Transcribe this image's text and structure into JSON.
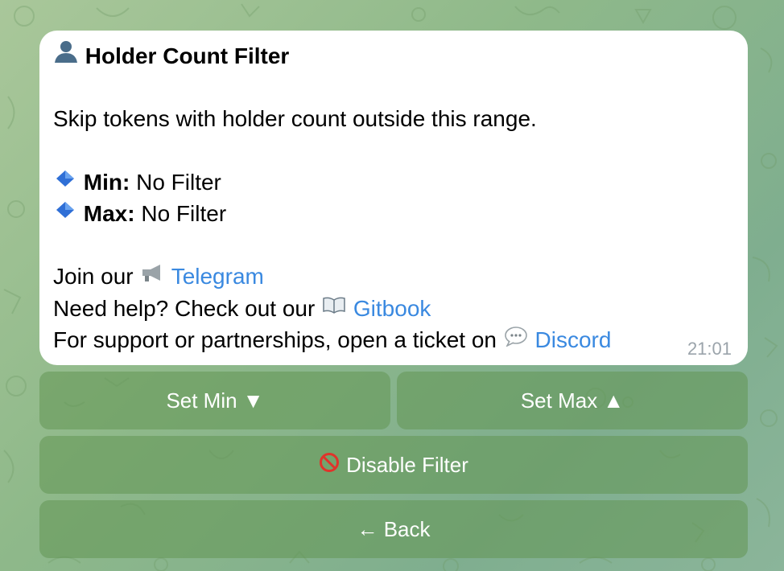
{
  "message": {
    "title": "Holder Count Filter",
    "description": "Skip tokens with holder count outside this range.",
    "min_label": "Min:",
    "min_value": " No Filter",
    "max_label": "Max:",
    "max_value": " No Filter",
    "join_prefix": "Join our ",
    "telegram_link": "Telegram",
    "help_prefix": "Need help? Check out our ",
    "gitbook_link": "Gitbook",
    "support_prefix": "For support or partnerships, open a ticket on ",
    "discord_link": "Discord",
    "time": "21:01",
    "icons": {
      "title": "user-silhouette-icon",
      "bullet": "blue-diamond-icon",
      "telegram": "megaphone-icon",
      "gitbook": "open-book-icon",
      "discord": "speech-bubble-icon"
    }
  },
  "keyboard": {
    "set_min_label": "Set Min ▼",
    "set_max_label": "Set Max ▲",
    "disable_label": "Disable Filter",
    "disable_icon": "prohibited-icon",
    "back_label": "← Back"
  },
  "colors": {
    "link": "#3a89e0",
    "button_bg": "#6e9e62",
    "background": "#8fb98a",
    "bullet_diamond": "#2f6fd6",
    "prohibited": "#e0332b"
  }
}
